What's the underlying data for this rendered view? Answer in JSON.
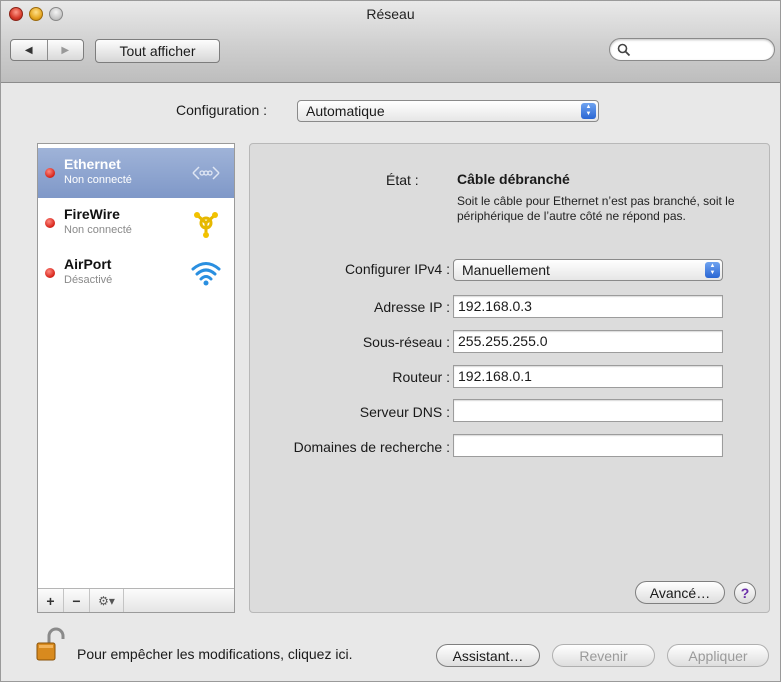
{
  "window": {
    "title": "Réseau"
  },
  "toolbar": {
    "back_glyph": "◀",
    "forward_glyph": "▶",
    "show_all_label": "Tout afficher",
    "search_placeholder": ""
  },
  "configuration": {
    "label": "Configuration :",
    "value": "Automatique"
  },
  "services": [
    {
      "name": "Ethernet",
      "status": "Non connecté",
      "icon": "ethernet-icon",
      "selected": true
    },
    {
      "name": "FireWire",
      "status": "Non connecté",
      "icon": "firewire-icon",
      "selected": false
    },
    {
      "name": "AirPort",
      "status": "Désactivé",
      "icon": "wifi-icon",
      "selected": false
    }
  ],
  "sidebar_buttons": {
    "add": "+",
    "remove": "−",
    "gear": "⚙▾"
  },
  "detail": {
    "etat_label": "État :",
    "etat_value": "Câble débranché",
    "etat_description": "Soit le câble pour Ethernet n’est pas branché, soit le périphérique de l’autre côté ne répond pas.",
    "ipv4_label": "Configurer IPv4 :",
    "ipv4_value": "Manuellement",
    "ip_label": "Adresse IP :",
    "ip_value": "192.168.0.3",
    "subnet_label": "Sous-réseau :",
    "subnet_value": "255.255.255.0",
    "router_label": "Routeur :",
    "router_value": "192.168.0.1",
    "dns_label": "Serveur DNS :",
    "dns_value": "",
    "search_domains_label": "Domaines de recherche :",
    "search_domains_value": "",
    "advanced_label": "Avancé…",
    "help_label": "?"
  },
  "footer": {
    "lock_text": "Pour empêcher les modifications, cliquez ici.",
    "assistant_label": "Assistant…",
    "revert_label": "Revenir",
    "apply_label": "Appliquer"
  },
  "colors": {
    "selection": "#8ea5d0",
    "status_dot": "#d8261c",
    "popup_arrows": "#2a66d3"
  }
}
